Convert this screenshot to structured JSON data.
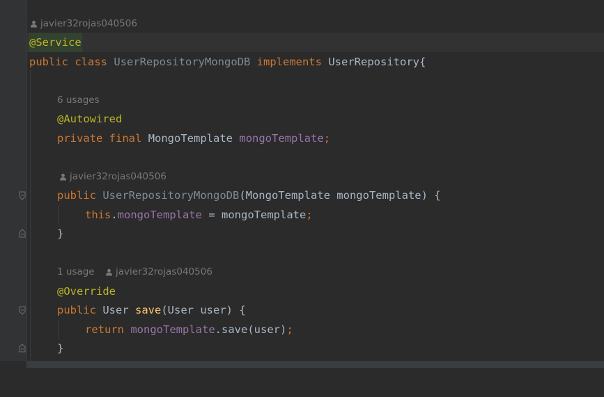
{
  "editor": {
    "author_hint_1": "javier32rojas040506",
    "line_service": "@Service",
    "line_class": {
      "public": "public",
      "class": "class",
      "name": "UserRepositoryMongoDB",
      "implements": "implements",
      "iface": "UserRepository{"
    },
    "usages_hint_1": "6 usages",
    "line_autowired": "@Autowired",
    "line_field": {
      "private": "private",
      "final": "final",
      "type": "MongoTemplate",
      "name": "mongoTemplate",
      "semi": ";"
    },
    "author_hint_2": "javier32rojas040506",
    "line_ctor": {
      "public": "public",
      "name": "UserRepositoryMongoDB",
      "params": "(MongoTemplate mongoTemplate) {"
    },
    "line_assign": {
      "this": "this",
      "dot": ".",
      "field": "mongoTemplate",
      "rest": " = mongoTemplate",
      "semi": ";"
    },
    "line_close_1": "}",
    "usages_hint_2": "1 usage",
    "author_hint_3": "javier32rojas040506",
    "line_override": "@Override",
    "line_save": {
      "public": "public",
      "ret": "User",
      "method": "save",
      "params": "(User user) {"
    },
    "line_return": {
      "return": "return",
      "field": "mongoTemplate",
      "rest": ".save(user)",
      "semi": ";"
    },
    "line_close_2": "}"
  },
  "colors": {
    "background": "#2b2b2b",
    "keyword": "#cc7832",
    "annotation": "#bbb529",
    "field": "#9876aa",
    "method": "#ffc66d",
    "text": "#a9b7c6"
  }
}
